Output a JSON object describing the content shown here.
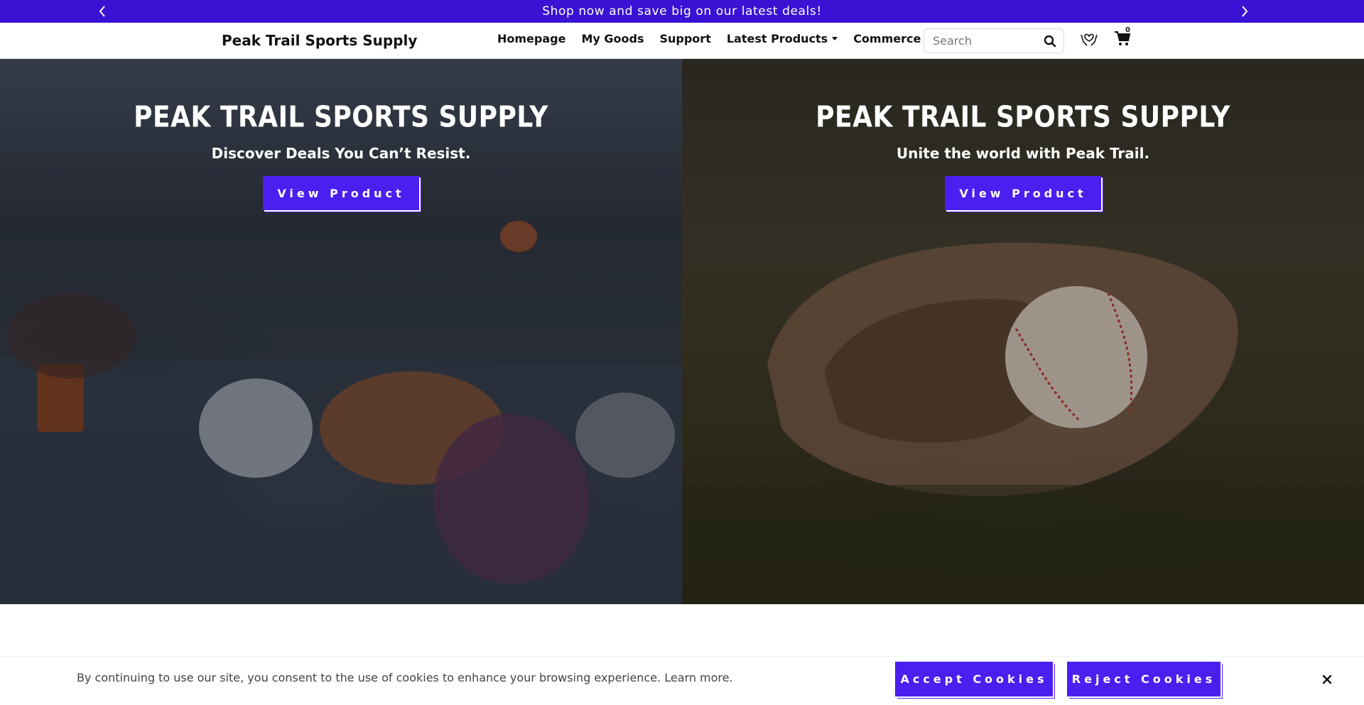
{
  "announcement": {
    "text": "Shop now and save big on our latest deals!",
    "prev_icon": "chevron-left-icon",
    "next_icon": "chevron-right-icon",
    "background": "#3a12d4"
  },
  "header": {
    "brand": "Peak Trail Sports Supply",
    "nav": [
      {
        "label": "Homepage"
      },
      {
        "label": "My Goods"
      },
      {
        "label": "Support"
      },
      {
        "label": "Latest Products",
        "has_dropdown": true
      },
      {
        "label": "Commerce"
      }
    ],
    "search": {
      "placeholder": "Search",
      "value": "",
      "icon": "search-icon"
    },
    "wishlist_icon": "hands-heart-icon",
    "cart": {
      "icon": "cart-icon",
      "count": "0"
    }
  },
  "hero": {
    "slides": [
      {
        "title": "PEAK TRAIL SPORTS SUPPLY",
        "subtitle": "Discover Deals You Can’t Resist.",
        "cta": "View Product"
      },
      {
        "title": "PEAK TRAIL SPORTS SUPPLY",
        "subtitle": "Unite the world with Peak Trail.",
        "cta": "View Product"
      }
    ]
  },
  "cookie": {
    "text": "By continuing to use our site, you consent to the use of cookies to enhance your browsing experience.",
    "learn_more": "Learn more.",
    "accept": "Accept Cookies",
    "reject": "Reject Cookies",
    "close_icon": "close-icon"
  },
  "colors": {
    "accent": "#4a1ff0",
    "announcement_bg": "#3a12d4"
  }
}
